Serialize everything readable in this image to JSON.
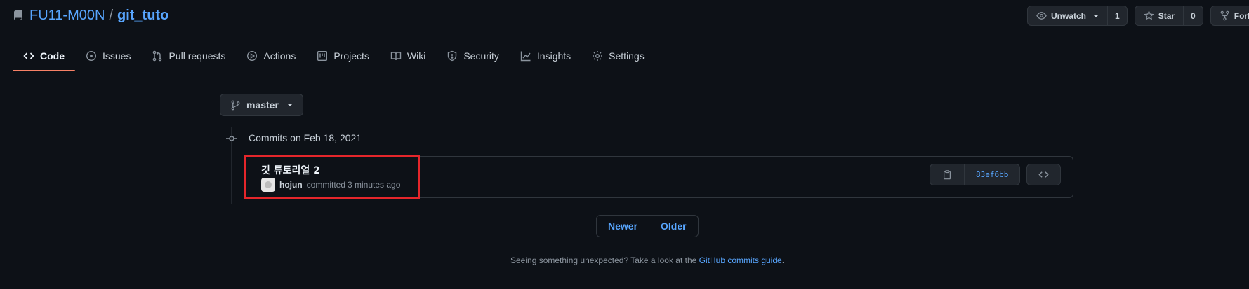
{
  "repo": {
    "owner": "FU11-M00N",
    "separator": "/",
    "name": "git_tuto"
  },
  "actions": {
    "watch_label": "Unwatch",
    "watch_count": "1",
    "star_label": "Star",
    "star_count": "0",
    "fork_label": "Fork"
  },
  "tabs": [
    {
      "label": "Code",
      "icon": "code-icon",
      "active": true
    },
    {
      "label": "Issues",
      "icon": "issue-icon"
    },
    {
      "label": "Pull requests",
      "icon": "pull-request-icon"
    },
    {
      "label": "Actions",
      "icon": "play-icon"
    },
    {
      "label": "Projects",
      "icon": "project-icon"
    },
    {
      "label": "Wiki",
      "icon": "book-icon"
    },
    {
      "label": "Security",
      "icon": "shield-icon"
    },
    {
      "label": "Insights",
      "icon": "graph-icon"
    },
    {
      "label": "Settings",
      "icon": "gear-icon"
    }
  ],
  "branch": {
    "label": "master"
  },
  "commits": {
    "heading": "Commits on Feb 18, 2021",
    "items": [
      {
        "title": "깃 튜토리얼 2",
        "author": "hojun",
        "action": "committed",
        "time": "3 minutes ago",
        "sha": "83ef6bb"
      }
    ]
  },
  "pager": {
    "newer": "Newer",
    "older": "Older"
  },
  "footer": {
    "text": "Seeing something unexpected? Take a look at the",
    "link": "GitHub commits guide",
    "end": "."
  },
  "colors": {
    "accent": "#58a6ff",
    "tab_underline": "#f78166",
    "highlight": "#e5262b",
    "background": "#0d1117"
  }
}
